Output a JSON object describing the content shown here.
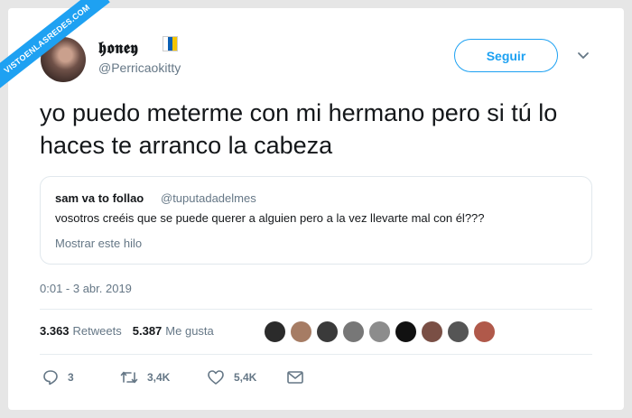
{
  "watermark": "VISTOENLASREDES.COM",
  "tweet": {
    "display_name": "𝖍𝖔𝖓𝖊𝖞",
    "handle": "@Perricaokitty",
    "follow_label": "Seguir",
    "text": "yo puedo meterme con mi hermano pero si tú lo haces te arranco la cabeza",
    "timestamp": "0:01 - 3 abr. 2019"
  },
  "quoted": {
    "name": "sam va to follao",
    "handle": "@tuputadadelmes",
    "text": "vosotros creéis que se puede querer a alguien pero a la vez llevarte mal con él???",
    "thread_link": "Mostrar este hilo"
  },
  "stats": {
    "retweets_count": "3.363",
    "retweets_label": "Retweets",
    "likes_count": "5.387",
    "likes_label": "Me gusta"
  },
  "likers_colors": [
    "#2b2b2b",
    "#a67c64",
    "#3a3a3a",
    "#777777",
    "#8c8c8c",
    "#111111",
    "#7a4f45",
    "#555555",
    "#b0594a"
  ],
  "actions": {
    "replies": "3",
    "retweets": "3,4K",
    "likes": "5,4K"
  }
}
